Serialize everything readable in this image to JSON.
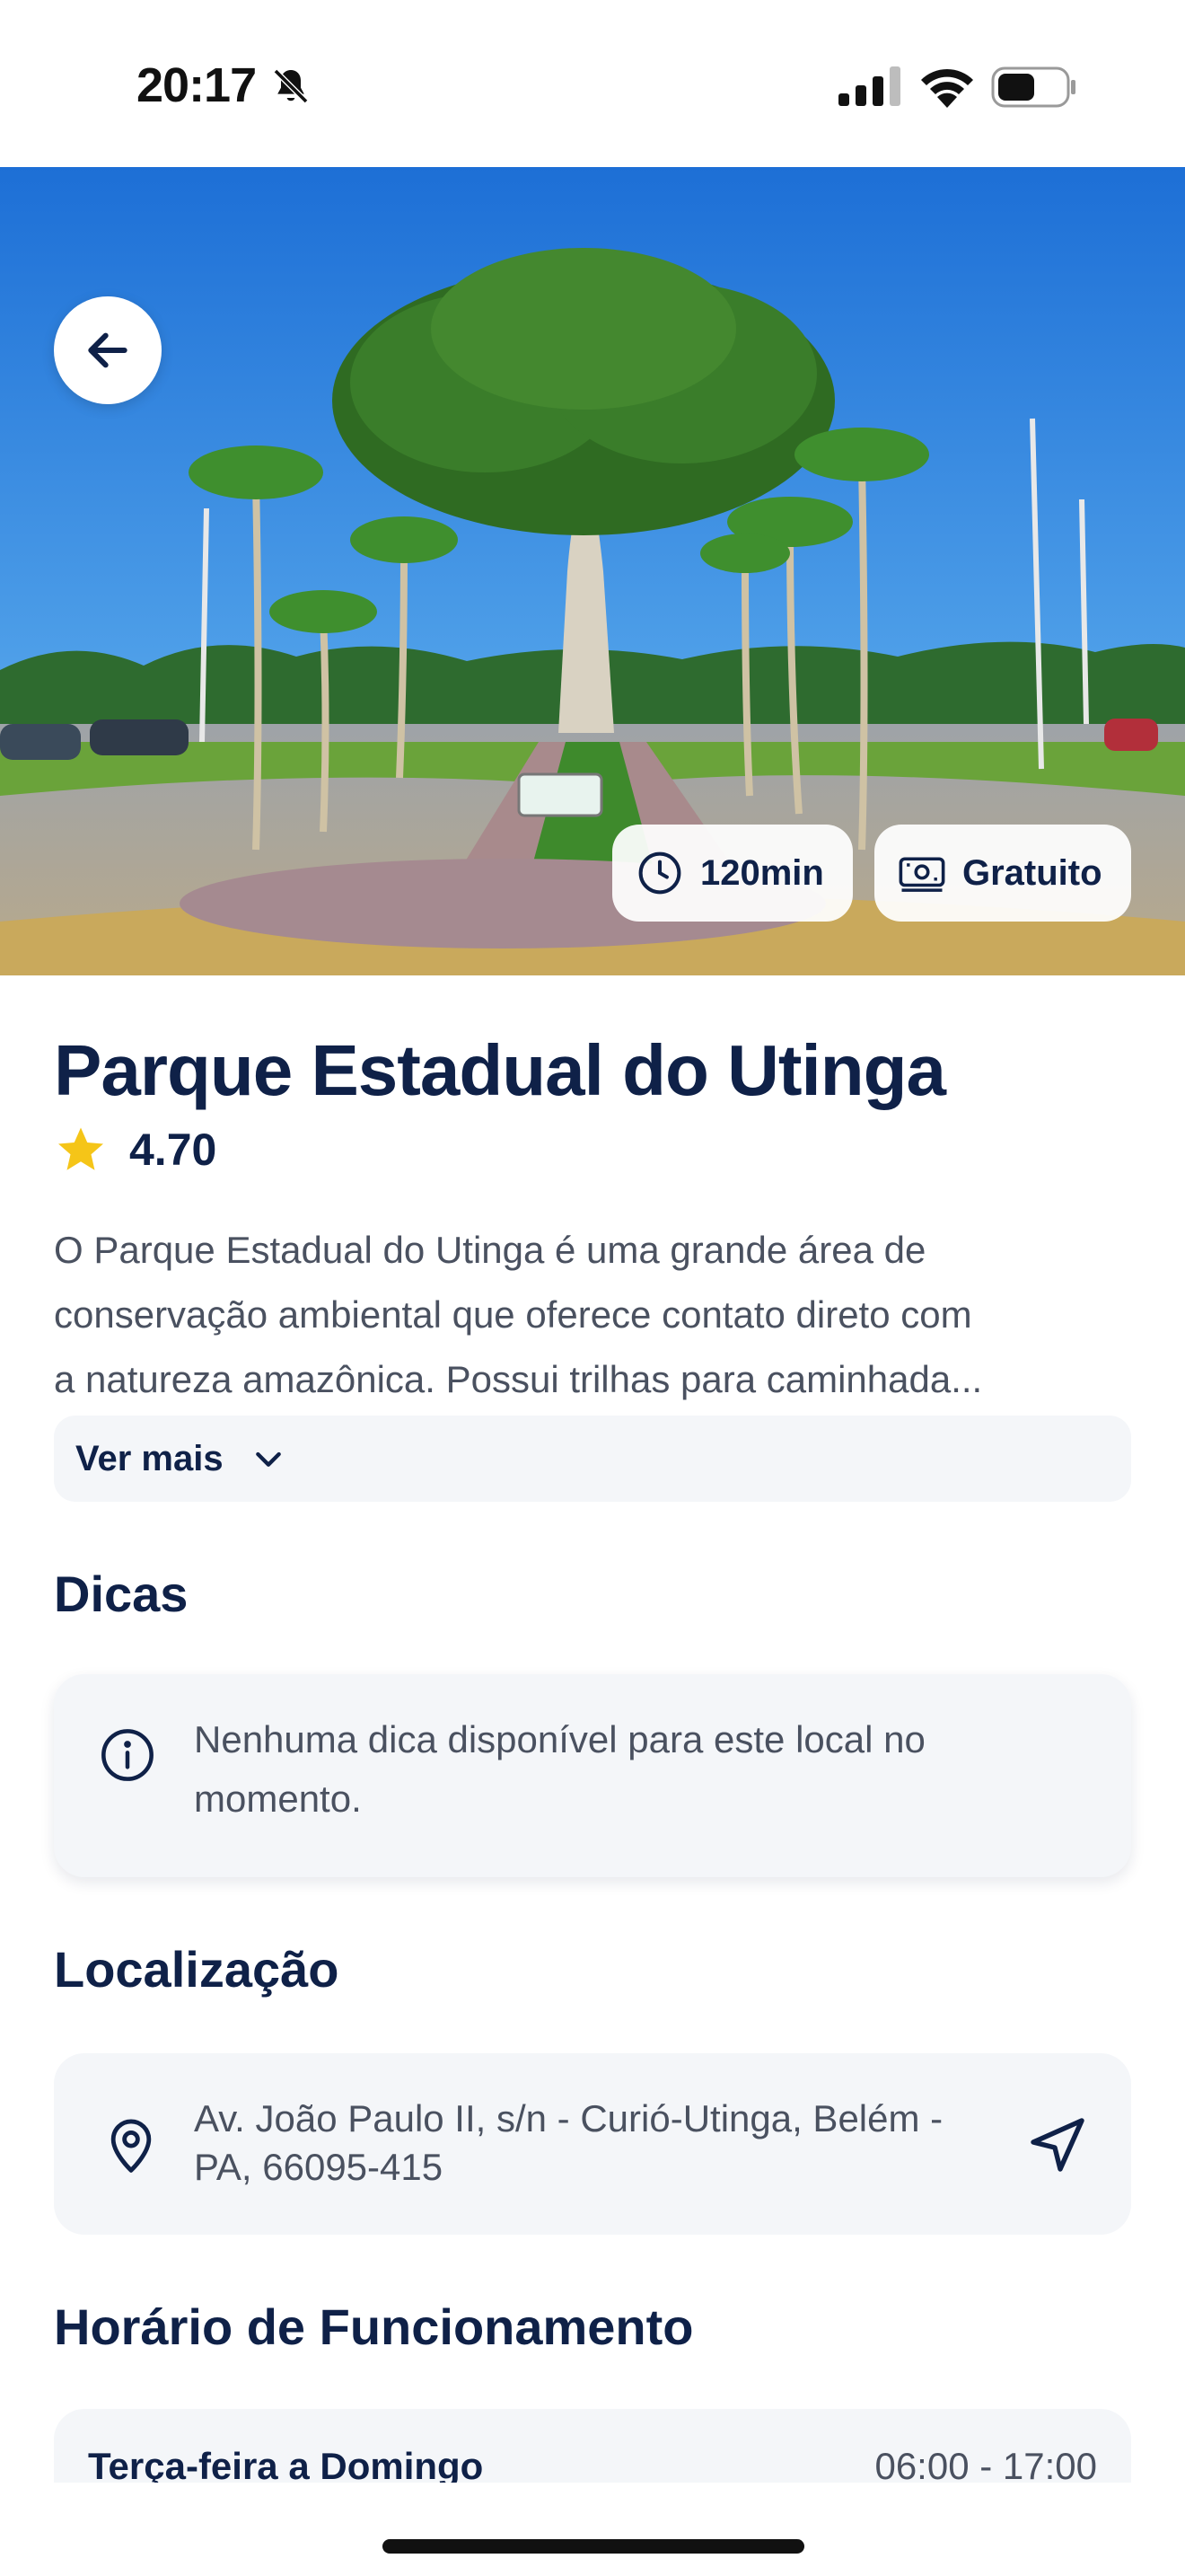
{
  "status_bar": {
    "time": "20:17",
    "icons": [
      "bell-slash-icon",
      "cellular-signal-icon",
      "wifi-icon",
      "battery-icon"
    ]
  },
  "hero": {
    "back_icon": "arrow-left-icon",
    "duration_label": "120min",
    "duration_icon": "clock-icon",
    "price_label": "Gratuito",
    "price_icon": "banknote-icon"
  },
  "place": {
    "name": "Parque Estadual do Utinga",
    "rating": "4.70",
    "rating_icon": "star-icon",
    "description_lines": [
      "O Parque Estadual do Utinga é uma grande área de",
      "conservação ambiental que oferece contato direto com",
      "a natureza amazônica. Possui trilhas para caminhada..."
    ],
    "see_more_label": "Ver mais"
  },
  "tips": {
    "title": "Dicas",
    "empty_message": "Nenhuma dica disponível para este local no momento."
  },
  "location": {
    "title": "Localização",
    "address": "Av. João Paulo II, s/n - Curió-Utinga, Belém - PA, 66095-415"
  },
  "hours": {
    "title": "Horário de Funcionamento",
    "rows": [
      {
        "days": "Terça-feira a Domingo",
        "time": "06:00 - 17:00"
      }
    ]
  },
  "colors": {
    "primary_text": "#0f2148",
    "secondary_text": "#4a5160",
    "card_background": "#f4f6f9",
    "star": "#f5c518"
  }
}
